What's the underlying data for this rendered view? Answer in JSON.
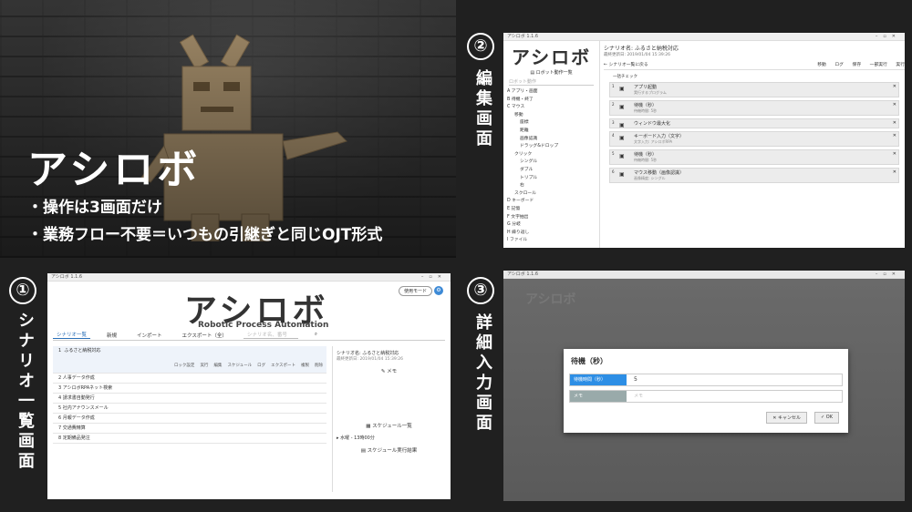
{
  "hero": {
    "title": "アシロボ",
    "bullet1": "・操作は3画面だけ",
    "bullet2": "・業務フロー不要＝いつもの引継ぎと同じOJT形式"
  },
  "labels": {
    "s1_num": "①",
    "s1_text": "シナリオ一覧画面",
    "s2_num": "②",
    "s2_text": "編集画面",
    "s3_num": "③",
    "s3_text": "詳細入力画面"
  },
  "screen1": {
    "window_title": "アシロボ 1.1.6",
    "logo": "アシロボ",
    "logo_sub": "Robotic Process Automation",
    "help_label": "使用モード",
    "tabs": [
      "シナリオ一覧",
      "新規",
      "インポート",
      "エクスポート（全）"
    ],
    "search_placeholder": "シナリオ名、番号",
    "rows": [
      "ふるさと納税対応",
      "人事データ作成",
      "アシロボRPAネット検索",
      "請求書自動発行",
      "社内アナウンスメール",
      "月報データ作成",
      "交通費精算",
      "定期備品発注"
    ],
    "row_numbers": [
      "1",
      "2",
      "3",
      "4",
      "5",
      "6",
      "7",
      "8"
    ],
    "actions": [
      "ロック設定",
      "実行",
      "編集",
      "スケジュール",
      "ログ",
      "エクスポート",
      "複製",
      "削除"
    ],
    "detail_title": "シナリオ名: ふるさと納税対応",
    "detail_updated": "最終更新日: 2019/01/04 15:39:26",
    "memo": "メモ",
    "schedule_list": "スケジュール一覧",
    "schedule_item": "水曜 - 13時00分",
    "schedule_result": "スケジュール実行結果"
  },
  "screen2": {
    "window_title": "アシロボ 1.1.6",
    "logo": "アシロボ",
    "robot_list": "ロボット動作一覧",
    "search_placeholder": "ロボット動作",
    "tree": [
      {
        "level": 1,
        "text": "A アプリ・画面"
      },
      {
        "level": 1,
        "text": "B 待機・終了"
      },
      {
        "level": 1,
        "text": "C マウス"
      },
      {
        "level": 2,
        "text": "移動"
      },
      {
        "level": 3,
        "text": "座標"
      },
      {
        "level": 3,
        "text": "距離"
      },
      {
        "level": 3,
        "text": "画像認識"
      },
      {
        "level": 3,
        "text": "ドラッグ&ドロップ"
      },
      {
        "level": 2,
        "text": "クリック"
      },
      {
        "level": 3,
        "text": "シングル"
      },
      {
        "level": 3,
        "text": "ダブル"
      },
      {
        "level": 3,
        "text": "トリプル"
      },
      {
        "level": 3,
        "text": "右"
      },
      {
        "level": 2,
        "text": "スクロール"
      },
      {
        "level": 1,
        "text": "D キーボード"
      },
      {
        "level": 1,
        "text": "E 記憶"
      },
      {
        "level": 1,
        "text": "F 文字抽出"
      },
      {
        "level": 1,
        "text": "G 分岐"
      },
      {
        "level": 1,
        "text": "H 繰り返し"
      },
      {
        "level": 1,
        "text": "I ファイル"
      }
    ],
    "scenario_name": "シナリオ名: ふるさと納税対応",
    "updated": "最終更新日: 2019/01/04 15:39:26",
    "back": "シナリオ一覧に戻る",
    "toolbar": [
      "移動",
      "ログ",
      "保存",
      "一部実行",
      "実行"
    ],
    "check": "一括チェック",
    "steps": [
      {
        "num": "1",
        "title": "アプリ起動",
        "sub": "実行するプログラム"
      },
      {
        "num": "2",
        "title": "待機（秒）",
        "sub": "待機時間: 5秒"
      },
      {
        "num": "3",
        "title": "ウィンドウ最大化",
        "sub": ""
      },
      {
        "num": "4",
        "title": "キーボード入力（文字）",
        "sub": "文字入力: アシロボRPA"
      },
      {
        "num": "5",
        "title": "待機（秒）",
        "sub": "待機時間: 5秒"
      },
      {
        "num": "6",
        "title": "マウス移動（画像認識）",
        "sub": "画像精度: シングル"
      }
    ]
  },
  "screen3": {
    "window_title": "アシロボ 1.1.6",
    "bg_logo": "アシロボ",
    "dialog_title": "待機（秒）",
    "field1_label": "待機時間（秒）",
    "field1_value": "5",
    "field2_label": "メモ",
    "field2_placeholder": "メモ",
    "cancel": "キャンセル",
    "ok": "OK"
  },
  "colors": {
    "accent": "#2d8ee5",
    "background": "#202020"
  }
}
